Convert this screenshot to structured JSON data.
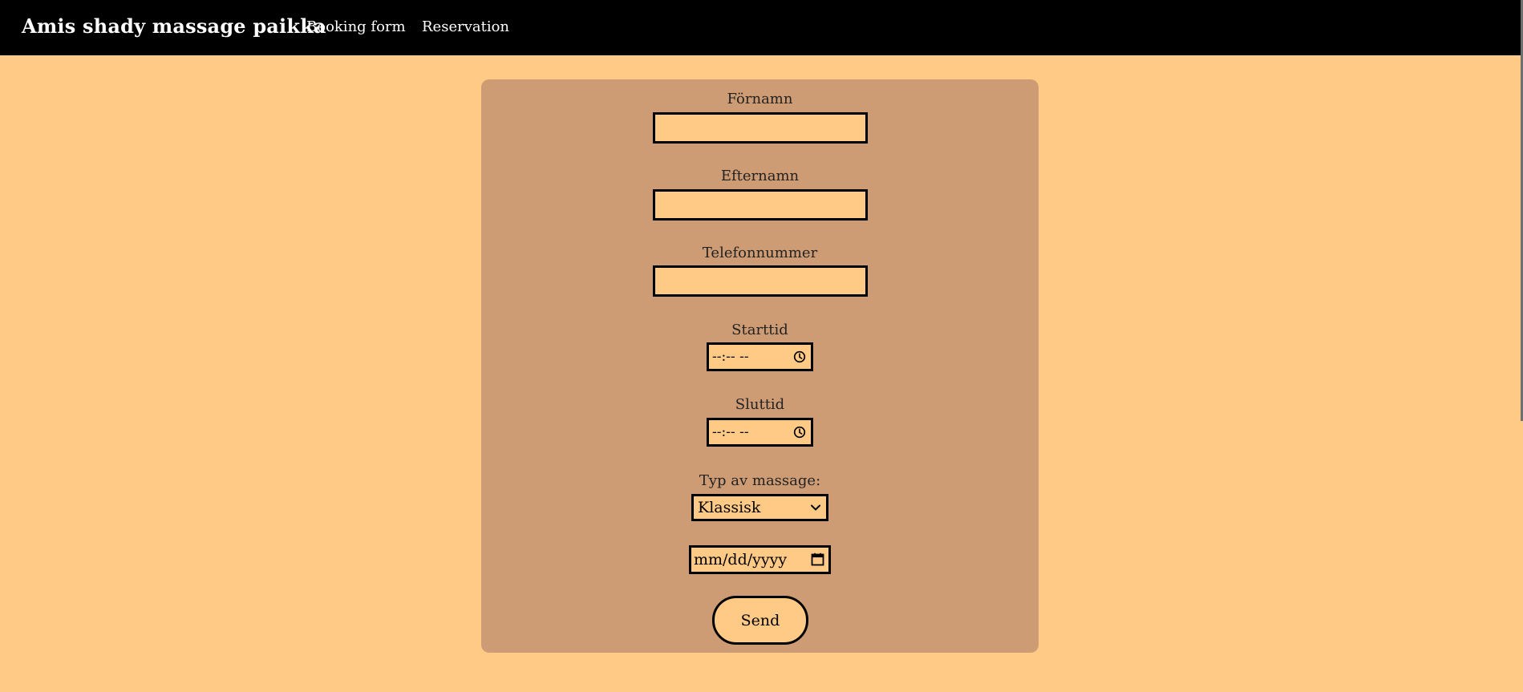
{
  "header": {
    "brand": "Amis shady massage paikka",
    "nav": [
      {
        "label": "Booking form"
      },
      {
        "label": "Reservation"
      }
    ]
  },
  "form": {
    "first_name_label": "Förnamn",
    "first_name_value": "",
    "last_name_label": "Efternamn",
    "last_name_value": "",
    "phone_label": "Telefonnummer",
    "phone_value": "",
    "start_time_label": "Starttid",
    "start_time_placeholder": "--:-- --",
    "end_time_label": "Sluttid",
    "end_time_placeholder": "--:-- --",
    "massage_type_label": "Typ av massage:",
    "massage_type_selected": "Klassisk",
    "date_placeholder": "mm/dd/yyyy",
    "submit_label": "Send"
  },
  "colors": {
    "page_background": "#FFCA86",
    "navbar_background": "#000000",
    "card_background": "#CE9C74",
    "input_background": "#FFCA86",
    "border": "#000000"
  },
  "icons": {
    "time": "clock-icon",
    "select": "chevron-down-icon",
    "date": "calendar-icon"
  }
}
